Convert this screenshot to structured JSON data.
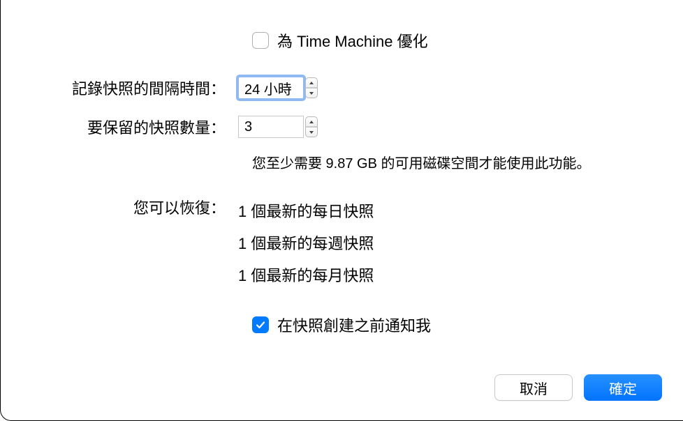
{
  "optimize": {
    "label": "為 Time Machine 優化",
    "checked": false
  },
  "interval": {
    "label": "記錄快照的間隔時間：",
    "value": "24 小時"
  },
  "count": {
    "label": "要保留的快照數量：",
    "value": "3"
  },
  "hint": "您至少需要 9.87 GB 的可用磁碟空間才能使用此功能。",
  "restore": {
    "label": "您可以恢復：",
    "items": [
      "1 個最新的每日快照",
      "1 個最新的每週快照",
      "1 個最新的每月快照"
    ]
  },
  "notify": {
    "label": "在快照創建之前通知我",
    "checked": true
  },
  "buttons": {
    "cancel": "取消",
    "ok": "確定"
  }
}
